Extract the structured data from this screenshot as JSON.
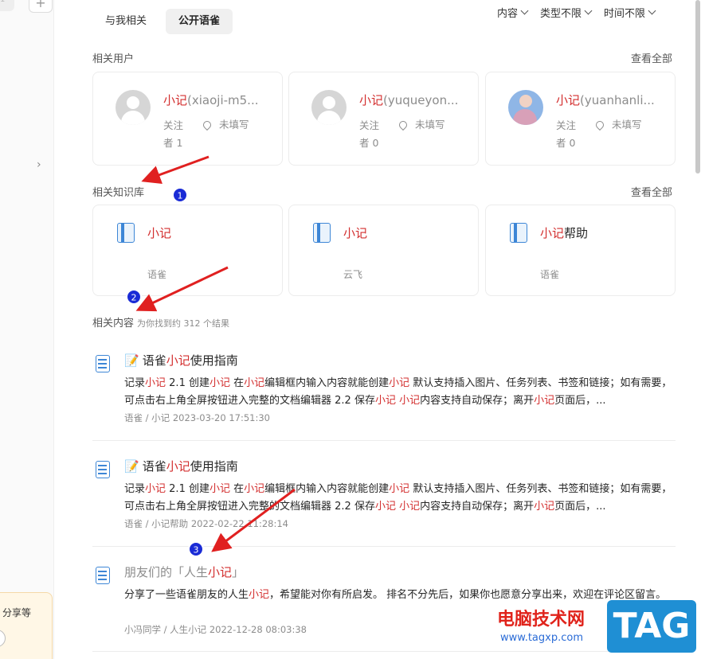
{
  "tabs": [
    "与我相关",
    "公开语雀"
  ],
  "filters": [
    "内容",
    "类型不限",
    "时间不限"
  ],
  "sections": {
    "users_title": "相关用户",
    "kb_title": "相关知识库",
    "content_title": "相关内容",
    "content_subtitle": "为你找到约 312 个结果",
    "see_all": "查看全部"
  },
  "users": [
    {
      "highlight": "小记",
      "handle": "(xiaoji-m5...",
      "follow_label": "关注",
      "follow_count": "者 1",
      "location": "未填写"
    },
    {
      "highlight": "小记",
      "handle": "(yuqueyon...",
      "follow_label": "关注",
      "follow_count": "者 0",
      "location": "未填写"
    },
    {
      "highlight": "小记",
      "handle": "(yuanhanli...",
      "follow_label": "关注",
      "follow_count": "者 0",
      "location": "未填写"
    }
  ],
  "knowledge_bases": [
    {
      "highlight": "小记",
      "suffix": "",
      "owner": "语雀"
    },
    {
      "highlight": "小记",
      "suffix": "",
      "owner": "云飞"
    },
    {
      "highlight": "小记",
      "suffix": "帮助",
      "owner": "语雀"
    }
  ],
  "results": [
    {
      "title_prefix": "语雀",
      "title_hl": "小记",
      "title_suffix": "使用指南",
      "text": [
        {
          "t": "记录"
        },
        {
          "h": "小记"
        },
        {
          "t": " 2.1 创建"
        },
        {
          "h": "小记"
        },
        {
          "t": " 在"
        },
        {
          "h": "小记"
        },
        {
          "t": "编辑框内输入内容就能创建"
        },
        {
          "h": "小记"
        },
        {
          "t": " 默认支持插入图片、任务列表、书签和链接；如有需要，可点击右上角全屏按钮进入完整的文档编辑器 2.2 保存"
        },
        {
          "h": "小记"
        },
        {
          "t": " "
        },
        {
          "h": "小记"
        },
        {
          "t": "内容支持自动保存；离开"
        },
        {
          "h": "小记"
        },
        {
          "t": "页面后，..."
        }
      ],
      "meta": "语雀 / 小记   2023-03-20 17:51:30"
    },
    {
      "title_prefix": "语雀",
      "title_hl": "小记",
      "title_suffix": "使用指南",
      "text": [
        {
          "t": "记录"
        },
        {
          "h": "小记"
        },
        {
          "t": " 2.1 创建"
        },
        {
          "h": "小记"
        },
        {
          "t": " 在"
        },
        {
          "h": "小记"
        },
        {
          "t": "编辑框内输入内容就能创建"
        },
        {
          "h": "小记"
        },
        {
          "t": " 默认支持插入图片、任务列表、书签和链接；如有需要，可点击右上角全屏按钮进入完整的文档编辑器 2.2 保存"
        },
        {
          "h": "小记"
        },
        {
          "t": " "
        },
        {
          "h": "小记"
        },
        {
          "t": "内容支持自动保存；离开"
        },
        {
          "h": "小记"
        },
        {
          "t": "页面后，..."
        }
      ],
      "meta": "语雀 / 小记帮助   2022-02-22 11:28:14"
    },
    {
      "title_prefix": "朋友们的「人生",
      "title_hl": "小记",
      "title_suffix": "」",
      "text": [
        {
          "t": "分享了一些语雀朋友的人生"
        },
        {
          "h": "小记"
        },
        {
          "t": "，希望能对你有所启发。 排名不分先后，如果你也愿意分享出来，欢迎在评论区留言。"
        }
      ],
      "meta": "小冯同学 / 人生小记   2022-12-28 08:03:38"
    }
  ],
  "annotations": [
    "1",
    "2",
    "3"
  ],
  "sidebar": {
    "promo_text": "分享等",
    "partial_chip": "1"
  },
  "watermark": {
    "cn": "电脑技术网",
    "url": "www.tagxp.com",
    "tag": "TAG"
  },
  "colors": {
    "highlight": "#d32f2f",
    "arrow": "#e02020",
    "badge": "#1a2bd6"
  }
}
